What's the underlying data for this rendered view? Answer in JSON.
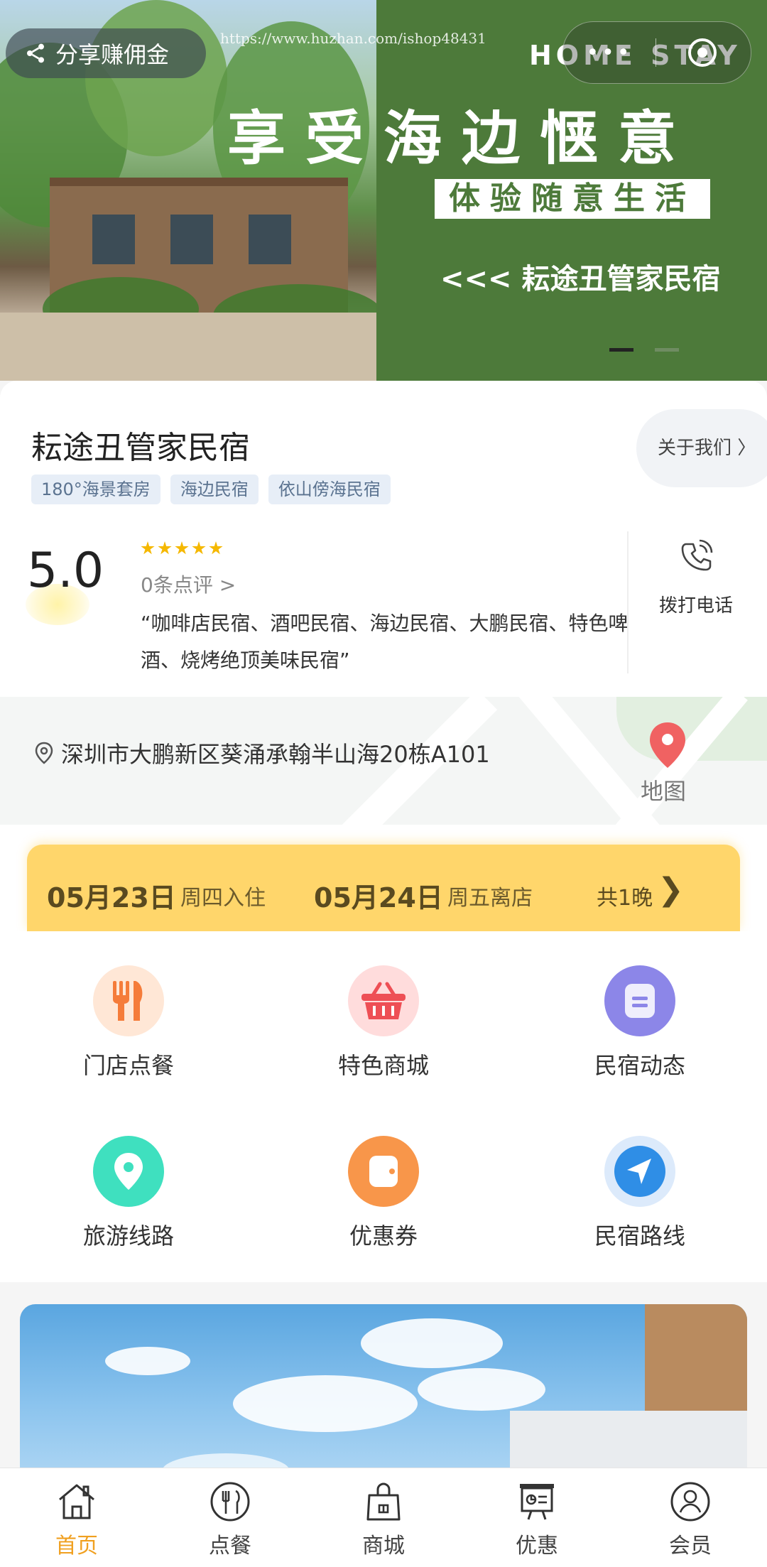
{
  "banner": {
    "share_label": "分享赚佣金",
    "url_watermark": "https://www.huzhan.com/ishop48431",
    "brand": "HOME STAY",
    "title": "享受海边惬意",
    "subtitle": "体验随意生活",
    "tagline": "<<< 耘途丑管家民宿",
    "capsule_dots": "•••",
    "colors": {
      "green": "#4d7a3a"
    }
  },
  "store": {
    "name": "耘途丑管家民宿",
    "about_label": "关于我们 〉",
    "tags": [
      "180°海景套房",
      "海边民宿",
      "依山傍海民宿"
    ],
    "score": "5.0",
    "rating_stars": 5,
    "reviews_label": "0条点评 >",
    "quote": "“咖啡店民宿、酒吧民宿、海边民宿、大鹏民宿、特色啤酒、烧烤绝顶美味民宿”",
    "call_label": "拨打电话"
  },
  "address": {
    "text": "深圳市大鹏新区葵涌承翰半山海20栋A101",
    "map_label": "地图"
  },
  "booking": {
    "checkin_date": "05月23日",
    "checkin_label": "周四入住",
    "checkout_date": "05月24日",
    "checkout_label": "周五离店",
    "nights": "共1晚",
    "chevron": "❯",
    "color": "#ffd66b"
  },
  "grid": [
    {
      "label": "门店点餐",
      "icon": "fork-knife-icon"
    },
    {
      "label": "特色商城",
      "icon": "basket-icon"
    },
    {
      "label": "民宿动态",
      "icon": "document-icon"
    },
    {
      "label": "旅游线路",
      "icon": "location-pin-icon"
    },
    {
      "label": "优惠券",
      "icon": "coupon-wallet-icon"
    },
    {
      "label": "民宿路线",
      "icon": "navigation-arrow-icon"
    }
  ],
  "tabs": [
    {
      "label": "首页",
      "icon": "home-icon",
      "active": true
    },
    {
      "label": "点餐",
      "icon": "dining-icon",
      "active": false
    },
    {
      "label": "商城",
      "icon": "shopping-bag-icon",
      "active": false
    },
    {
      "label": "优惠",
      "icon": "presentation-icon",
      "active": false
    },
    {
      "label": "会员",
      "icon": "user-icon",
      "active": false
    }
  ],
  "accent": "#f0a020"
}
